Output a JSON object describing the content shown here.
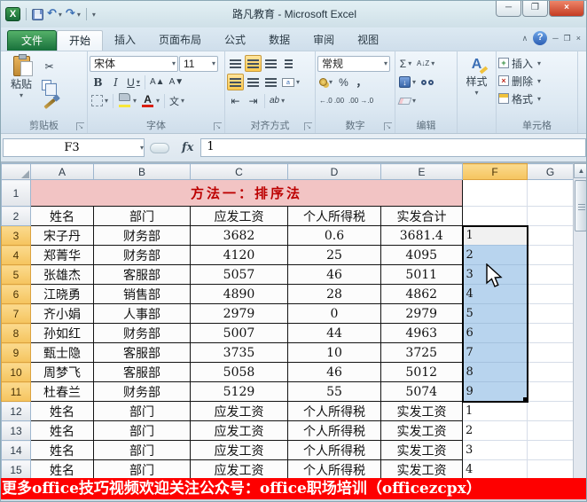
{
  "window": {
    "title": "路凡教育 - Microsoft Excel"
  },
  "tabs": {
    "file": "文件",
    "items": [
      "开始",
      "插入",
      "页面布局",
      "公式",
      "数据",
      "审阅",
      "视图"
    ],
    "active": "开始"
  },
  "ribbon": {
    "clipboard": {
      "paste": "粘贴",
      "label": "剪贴板"
    },
    "font": {
      "name": "宋体",
      "size": "11",
      "label": "字体"
    },
    "alignment": {
      "label": "对齐方式"
    },
    "number": {
      "format": "常规",
      "label": "数字",
      "inc_decimal": "←.0 .00",
      "dec_decimal": ".00 →.0"
    },
    "editing": {
      "label": "编辑"
    },
    "styles": {
      "label": "样式"
    },
    "cells": {
      "insert": "插入",
      "delete": "删除",
      "format": "格式",
      "label": "单元格"
    }
  },
  "icons": {
    "undo": "↶",
    "redo": "↷",
    "excel": "X",
    "question": "?",
    "minimize": "─",
    "restore": "❐",
    "close": "×",
    "chevron-up": "∧",
    "scissors": "✂",
    "bold": "B",
    "italic": "I",
    "underline": "U",
    "grow-font": "A▲",
    "shrink-font": "A▼",
    "phonetic": "文",
    "merge": "a",
    "indent-dec": "⇤",
    "indent-inc": "⇥",
    "orientation": "ab",
    "percent": "%",
    "comma": "，",
    "sum": "Σ",
    "sort": "A↓Z",
    "fill-down": "↓",
    "scroll-up": "▲",
    "launcher": "↘"
  },
  "formula_bar": {
    "name_box": "F3",
    "fx": "fx",
    "content": "1"
  },
  "sheet": {
    "col_headers": [
      "A",
      "B",
      "C",
      "D",
      "E",
      "F",
      "G"
    ],
    "selected_col": "F",
    "selection": "F3:F11",
    "rows": [
      {
        "n": "1",
        "type": "banner",
        "text": "方法一：排序法",
        "f": "",
        "h": 30
      },
      {
        "n": "2",
        "cells": [
          "姓名",
          "部门",
          "应发工资",
          "个人所得税",
          "实发合计"
        ],
        "f": ""
      },
      {
        "n": "3",
        "cells": [
          "宋子丹",
          "财务部",
          "3682",
          "0.6",
          "3681.4"
        ],
        "f": "1"
      },
      {
        "n": "4",
        "cells": [
          "郑菁华",
          "财务部",
          "4120",
          "25",
          "4095"
        ],
        "f": "2"
      },
      {
        "n": "5",
        "cells": [
          "张雄杰",
          "客服部",
          "5057",
          "46",
          "5011"
        ],
        "f": "3"
      },
      {
        "n": "6",
        "cells": [
          "江晓勇",
          "销售部",
          "4890",
          "28",
          "4862"
        ],
        "f": "4"
      },
      {
        "n": "7",
        "cells": [
          "齐小娟",
          "人事部",
          "2979",
          "0",
          "2979"
        ],
        "f": "5"
      },
      {
        "n": "8",
        "cells": [
          "孙如红",
          "财务部",
          "5007",
          "44",
          "4963"
        ],
        "f": "6"
      },
      {
        "n": "9",
        "cells": [
          "甄士隐",
          "客服部",
          "3735",
          "10",
          "3725"
        ],
        "f": "7"
      },
      {
        "n": "10",
        "cells": [
          "周梦飞",
          "客服部",
          "5058",
          "46",
          "5012"
        ],
        "f": "8"
      },
      {
        "n": "11",
        "cells": [
          "杜春兰",
          "财务部",
          "5129",
          "55",
          "5074"
        ],
        "f": "9"
      },
      {
        "n": "12",
        "cells": [
          "姓名",
          "部门",
          "应发工资",
          "个人所得税",
          "实发工资"
        ],
        "f": "1"
      },
      {
        "n": "13",
        "cells": [
          "姓名",
          "部门",
          "应发工资",
          "个人所得税",
          "实发工资"
        ],
        "f": "2"
      },
      {
        "n": "14",
        "cells": [
          "姓名",
          "部门",
          "应发工资",
          "个人所得税",
          "实发工资"
        ],
        "f": "3"
      },
      {
        "n": "15",
        "cells": [
          "姓名",
          "部门",
          "应发工资",
          "个人所得税",
          "实发工资"
        ],
        "f": "4"
      }
    ]
  },
  "footer": {
    "text": "更多office技巧视频欢迎关注公众号：office职场培训（officezcpx）"
  },
  "colors": {
    "banner_bg": "#fe0000",
    "title_row_bg": "#f2c4c4",
    "title_row_text": "#bc0000",
    "selection_fill": "#b8d4ee",
    "selected_header": "#f5c45e",
    "file_tab_green": "#17703b"
  }
}
